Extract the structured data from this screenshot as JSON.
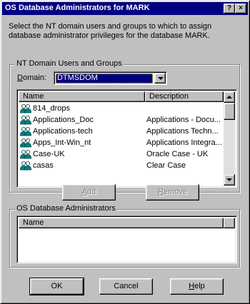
{
  "window": {
    "title": "OS Database Administrators for MARK",
    "help_glyph": "?",
    "close_glyph": "×"
  },
  "instructions": "Select the NT domain users and groups to which to assign database administrator privileges for the database MARK.",
  "domain_group": {
    "label": "NT Domain Users and Groups",
    "domain_label_accel": "D",
    "domain_label_rest": "omain:",
    "domain_value": "DTMSDOM",
    "columns": [
      "Name",
      "Description"
    ],
    "rows": [
      {
        "name": "814_drops",
        "description": ""
      },
      {
        "name": "Applications_Doc",
        "description": "Applications - Docu..."
      },
      {
        "name": "Applications-tech",
        "description": "Applications Techn..."
      },
      {
        "name": "Apps_Int-Win_nt",
        "description": "Applications Integra..."
      },
      {
        "name": "Case-UK",
        "description": "Oracle Case - UK"
      },
      {
        "name": "casas",
        "description": "Clear Case"
      }
    ],
    "icon": "user-group-icon"
  },
  "buttons": {
    "add_accel": "A",
    "add_rest": "dd",
    "remove_accel": "R",
    "remove_rest": "emove",
    "ok": "OK",
    "cancel": "Cancel",
    "help_accel": "H",
    "help_rest": "elp"
  },
  "admins_group": {
    "label": "OS Database Administrators",
    "columns": [
      "Name"
    ]
  },
  "colors": {
    "face": "#c0c0c0",
    "titlebar": "#000080",
    "selection": "#000080"
  }
}
